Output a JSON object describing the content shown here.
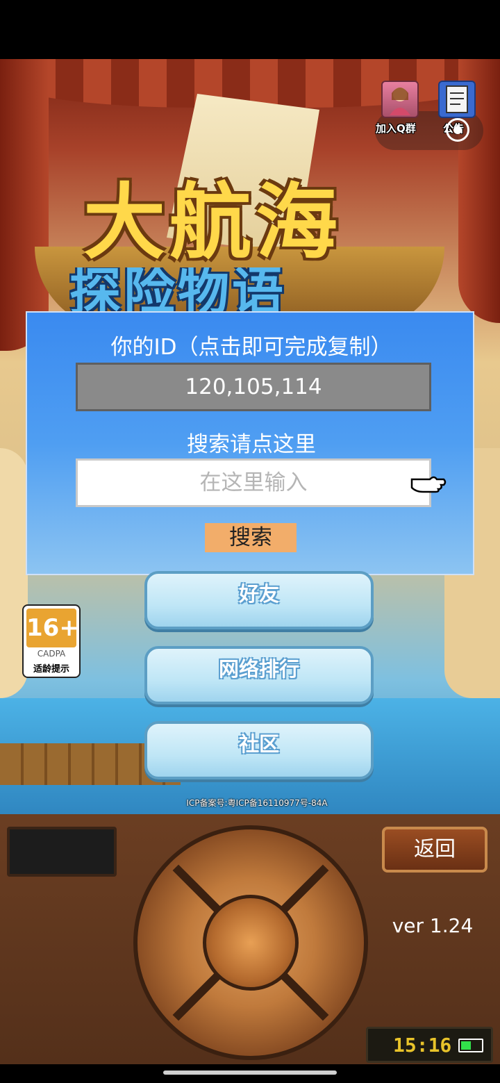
{
  "top_right": {
    "join_group_label": "加入Q群",
    "announcement_label": "公告"
  },
  "logo": {
    "title_line1": "大航海",
    "title_line2": "探险物语"
  },
  "dialog": {
    "id_label": "你的ID（点击即可完成复制）",
    "id_value": "120,105,114",
    "search_label": "搜索请点这里",
    "search_placeholder": "在这里输入",
    "search_button": "搜索"
  },
  "menu": {
    "items": [
      {
        "label": "好友"
      },
      {
        "label": "网络排行"
      },
      {
        "label": "社区"
      }
    ]
  },
  "age_rating": {
    "age": "16+",
    "org": "CADPA",
    "tip": "适龄提示"
  },
  "icp": "ICP备案号:粤ICP备16110977号-84A",
  "console": {
    "back_label": "返回",
    "version": "ver 1.24",
    "clock": "15:16",
    "battery_level": 0.5
  },
  "colors": {
    "dialog_blue": "#3a8af0",
    "search_button": "#f2ad6a",
    "clock_digits": "#e8c32a",
    "battery_fill": "#32e04a"
  }
}
